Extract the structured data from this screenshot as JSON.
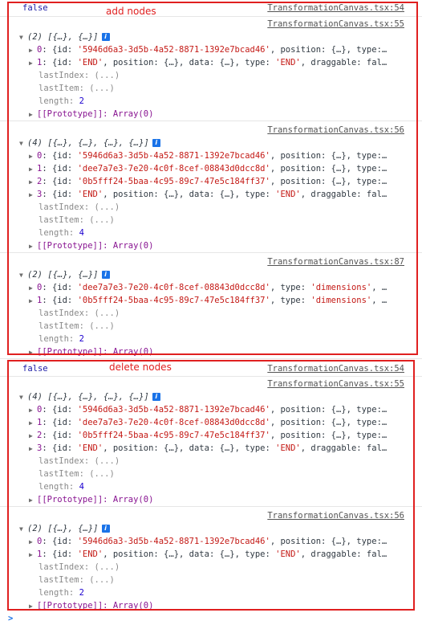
{
  "annotations": {
    "add_nodes": "add nodes",
    "delete_nodes": "delete nodes"
  },
  "logs": {
    "false_value": "false",
    "src_54": "TransformationCanvas.tsx:54",
    "src_55": "TransformationCanvas.tsx:55",
    "src_56": "TransformationCanvas.tsx:56",
    "src_87": "TransformationCanvas.tsx:87",
    "hdr2": "(2) [{…}, {…}]",
    "hdr4": "(4) [{…}, {…}, {…}, {…}]",
    "lastIndex": "lastIndex: (...)",
    "lastItem": "lastItem: (...)",
    "length2": "length: 2",
    "length4": "length: 4",
    "proto": "[[Prototype]]: Array(0)",
    "arr2_end": [
      "0: {id: '5946d6a3-3d5b-4a52-8871-1392e7bcad46', position: {…}, type:…",
      "1: {id: 'END', position: {…}, data: {…}, type: 'END', draggable: fal…"
    ],
    "arr4": [
      "0: {id: '5946d6a3-3d5b-4a52-8871-1392e7bcad46', position: {…}, type:…",
      "1: {id: 'dee7a7e3-7e20-4c0f-8cef-08843d0dcc8d', position: {…}, type:…",
      "2: {id: '0b5fff24-5baa-4c95-89c7-47e5c184ff37', position: {…}, type:…",
      "3: {id: 'END', position: {…}, data: {…}, type: 'END', draggable: fal…"
    ],
    "arr2_dim": [
      "0: {id: 'dee7a7e3-7e20-4c0f-8cef-08843d0dcc8d', type: 'dimensions', …",
      "1: {id: '0b5fff24-5baa-4c95-89c7-47e5c184ff37', type: 'dimensions', …"
    ],
    "prompt": ">"
  }
}
